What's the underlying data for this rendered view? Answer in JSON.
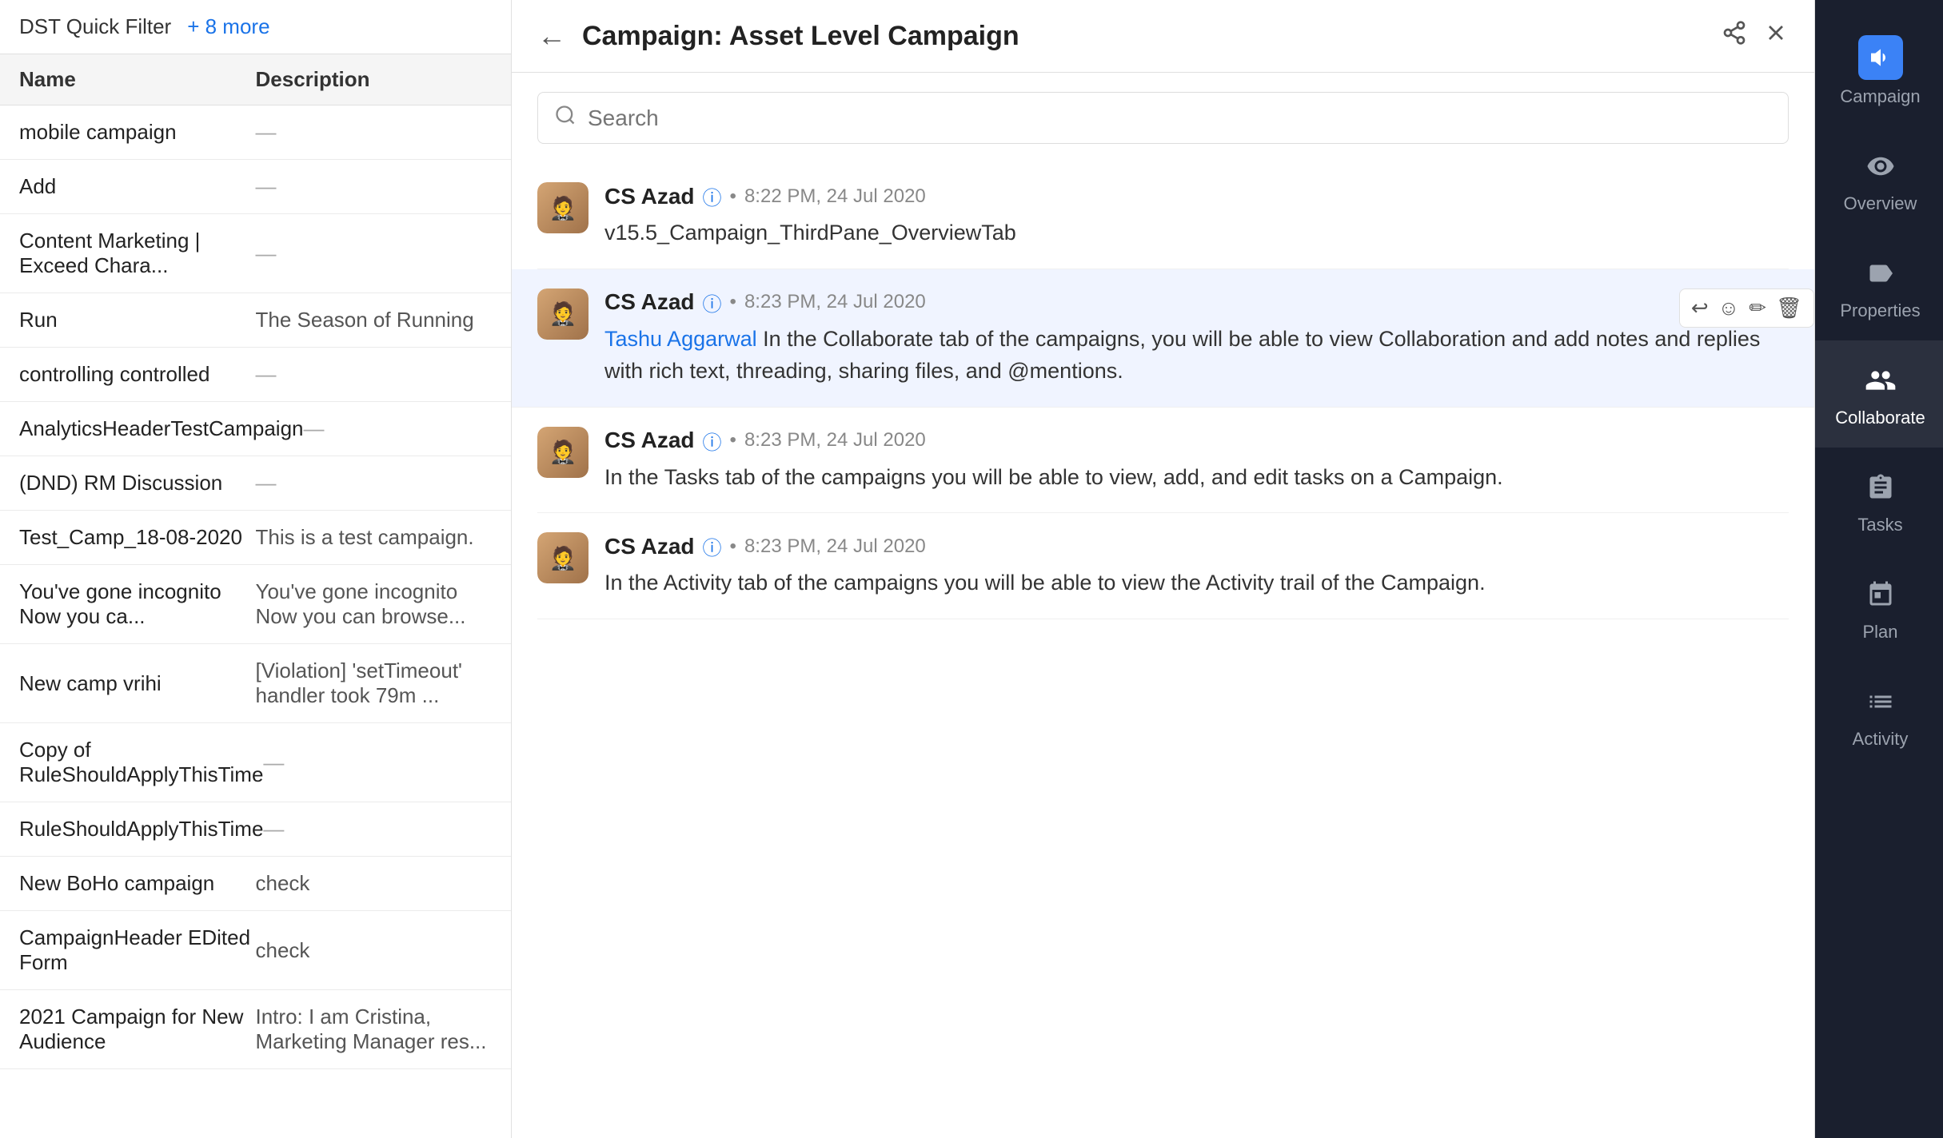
{
  "left_panel": {
    "filter_label": "DST Quick Filter",
    "filter_more": "+ 8 more",
    "columns": [
      "Name",
      "Description"
    ],
    "rows": [
      {
        "name": "mobile campaign",
        "desc": "—"
      },
      {
        "name": "Add",
        "desc": "—"
      },
      {
        "name": "Content Marketing | Exceed Chara...",
        "desc": "—"
      },
      {
        "name": "Run",
        "desc": "The Season of Running"
      },
      {
        "name": "controlling controlled",
        "desc": "—"
      },
      {
        "name": "AnalyticsHeaderTestCampaign",
        "desc": "—"
      },
      {
        "name": "(DND) RM Discussion",
        "desc": "—"
      },
      {
        "name": "Test_Camp_18-08-2020",
        "desc": "This is a test campaign."
      },
      {
        "name": "You've gone incognito Now you ca...",
        "desc": "You've gone incognito Now you can browse..."
      },
      {
        "name": "New camp vrihi",
        "desc": "[Violation] 'setTimeout' handler took 79m ..."
      },
      {
        "name": "Copy of RuleShouldApplyThisTime",
        "desc": "—"
      },
      {
        "name": "RuleShouldApplyThisTime",
        "desc": "—"
      },
      {
        "name": "New BoHo campaign",
        "desc": "check"
      },
      {
        "name": "CampaignHeader EDited Form",
        "desc": "check"
      },
      {
        "name": "2021 Campaign for New Audience",
        "desc": "Intro: I am Cristina, Marketing Manager res..."
      }
    ]
  },
  "detail_panel": {
    "title": "Campaign: Asset Level Campaign",
    "search_placeholder": "Search",
    "messages": [
      {
        "sender": "CS Azad",
        "time": "8:22 PM, 24 Jul 2020",
        "text": "v15.5_Campaign_ThirdPane_OverviewTab",
        "highlighted": false
      },
      {
        "sender": "CS Azad",
        "time": "8:23 PM, 24 Jul 2020",
        "mention": "Tashu Aggarwal",
        "text": " In the Collaborate tab of the campaigns, you will be able to view Collaboration and add notes and replies with rich text, threading, sharing files, and @mentions.",
        "highlighted": true,
        "show_actions": true
      },
      {
        "sender": "CS Azad",
        "time": "8:23 PM, 24 Jul 2020",
        "text": "In the Tasks tab of the campaigns you will be able to view, add, and edit tasks on a Campaign.",
        "highlighted": false
      },
      {
        "sender": "CS Azad",
        "time": "8:23 PM, 24 Jul 2020",
        "text": "In the Activity tab of the campaigns you will be able to view the Activity trail of the Campaign.",
        "highlighted": false
      }
    ]
  },
  "sidebar": {
    "items": [
      {
        "id": "campaign",
        "label": "Campaign",
        "icon": "📣",
        "active": false
      },
      {
        "id": "overview",
        "label": "Overview",
        "icon": "👁",
        "active": false
      },
      {
        "id": "properties",
        "label": "Properties",
        "icon": "🏷",
        "active": false
      },
      {
        "id": "collaborate",
        "label": "Collaborate",
        "icon": "👥",
        "active": true
      },
      {
        "id": "tasks",
        "label": "Tasks",
        "icon": "📋",
        "active": false
      },
      {
        "id": "plan",
        "label": "Plan",
        "icon": "📅",
        "active": false
      },
      {
        "id": "activity",
        "label": "Activity",
        "icon": "≡",
        "active": false
      }
    ]
  }
}
